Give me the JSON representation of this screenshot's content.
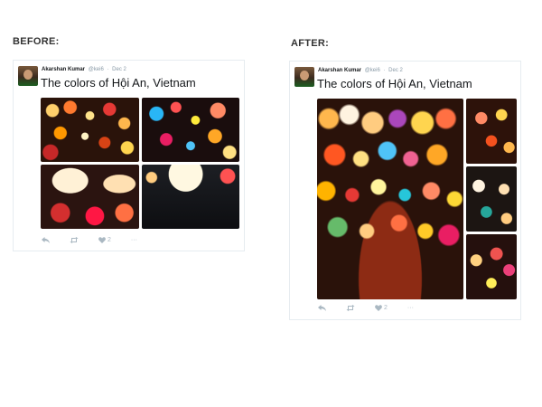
{
  "labels": {
    "before": "BEFORE:",
    "after": "AFTER:"
  },
  "tweet": {
    "author_name": "Akarshan Kumar",
    "handle": "@kei6",
    "separator": "·",
    "date": "Dec 2",
    "text": "The colors of Hội An, Vietnam",
    "like_count": "2",
    "more": "···"
  },
  "icons": {
    "reply": "reply-icon",
    "retweet": "retweet-icon",
    "like": "heart-icon",
    "more": "more-icon"
  },
  "colors": {
    "text": "#14171a",
    "muted": "#8899a6",
    "action": "#aab8c2",
    "border": "#e6ecf0"
  }
}
